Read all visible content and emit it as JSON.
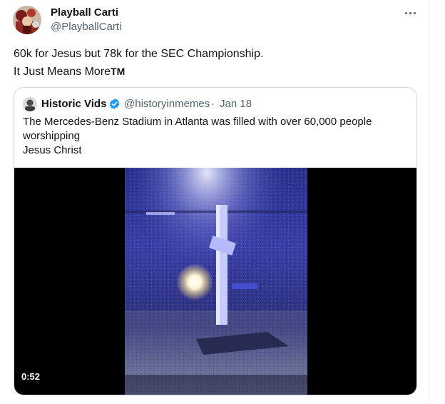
{
  "tweet": {
    "author": {
      "display_name": "Playball Carti",
      "handle": "@PlayballCarti",
      "avatar": "user-avatar"
    },
    "more_icon": "more-horizontal-icon",
    "text_lines": [
      "60k for Jesus but 78k for the SEC Championship.",
      "It Just Means More"
    ],
    "trademark": "TM"
  },
  "quote": {
    "author": {
      "display_name": "Historic Vids",
      "verified_icon": "verified-badge-icon",
      "handle": "@historyinmemes",
      "separator": "·",
      "date": "Jan 18"
    },
    "text_lines": [
      "The Mercedes-Benz Stadium in Atlanta was filled with over 60,000 people",
      "worshipping",
      "Jesus Christ"
    ],
    "video": {
      "duration": "0:52",
      "description_icon": "stadium-cross-video-thumbnail"
    }
  },
  "colors": {
    "text_primary": "#0f1419",
    "text_secondary": "#536471",
    "border": "#cfd9de",
    "verified": "#1d9bf0",
    "video_bg": "#000000"
  }
}
